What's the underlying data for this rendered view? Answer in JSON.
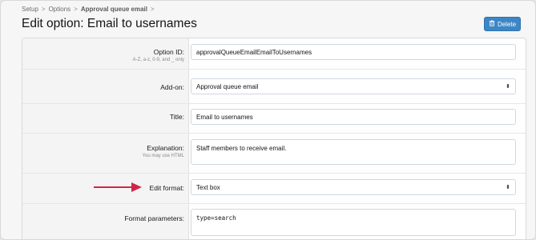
{
  "breadcrumb": {
    "items": [
      "Setup",
      "Options",
      "Approval queue email"
    ],
    "separator": ">"
  },
  "page": {
    "title": "Edit option: Email to usernames",
    "delete_label": "Delete"
  },
  "form": {
    "option_id": {
      "label": "Option ID:",
      "hint": "A-Z, a-z, 0-9, and _ only",
      "value": "approvalQueueEmailEmailToUsernames"
    },
    "add_on": {
      "label": "Add-on:",
      "value": "Approval queue email"
    },
    "title": {
      "label": "Title:",
      "value": "Email to usernames"
    },
    "explanation": {
      "label": "Explanation:",
      "hint": "You may use HTML",
      "value": "Staff members to receive email."
    },
    "edit_format": {
      "label": "Edit format:",
      "value": "Text box"
    },
    "format_parameters": {
      "label": "Format parameters:",
      "value": "type=search"
    }
  },
  "colors": {
    "delete_button": "#3d86c6",
    "annotation_arrow": "#d0254a"
  },
  "icons": {
    "delete": "trash-icon",
    "select_caret": "updown-caret-icon",
    "annotation": "arrow-right-icon"
  }
}
